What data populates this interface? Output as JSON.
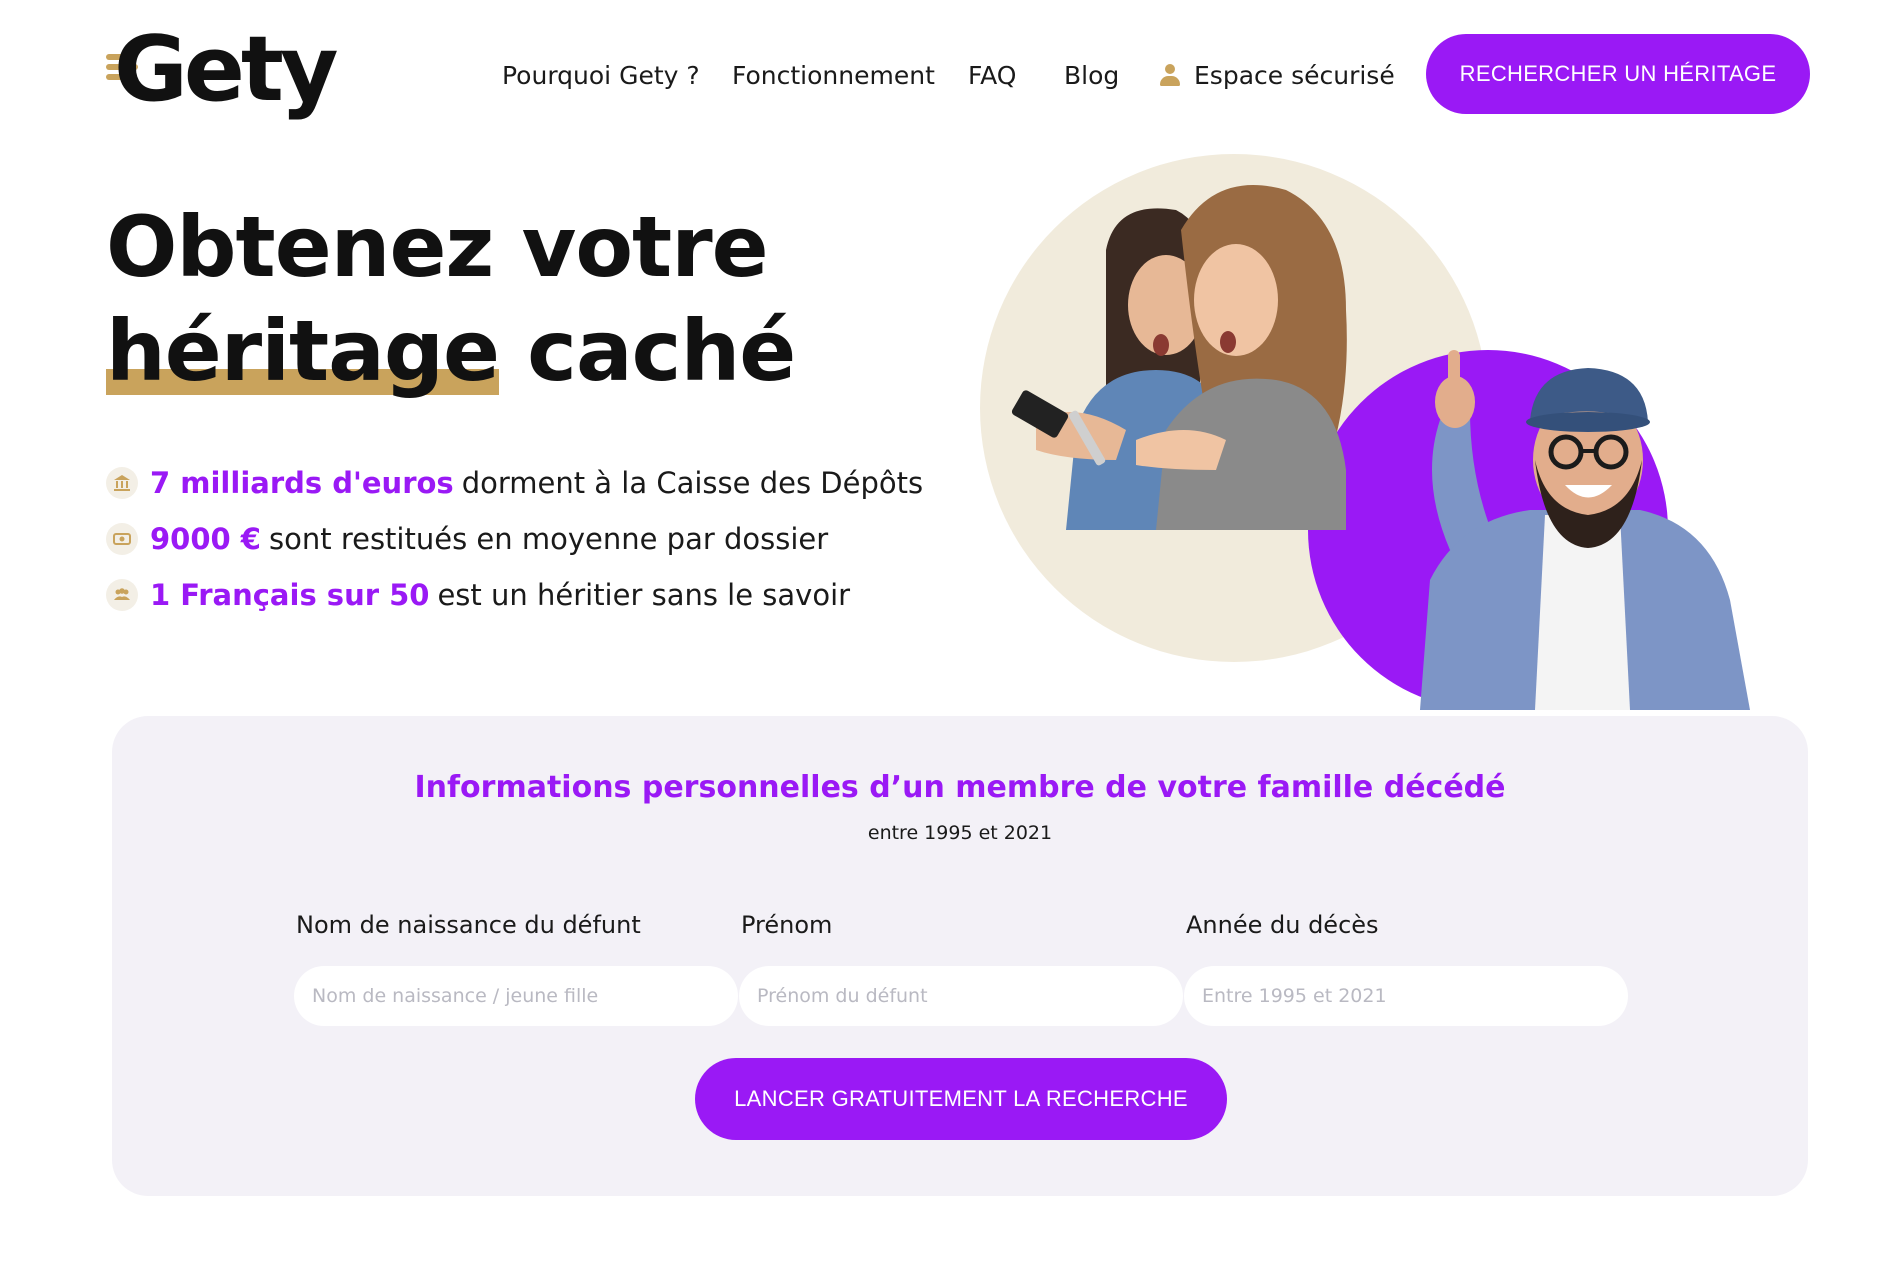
{
  "brand": {
    "logo_text": "Gety",
    "accent_color": "#9a19f5",
    "gold_color": "#c9a35c"
  },
  "nav": {
    "items": [
      {
        "label": "Pourquoi Gety ?"
      },
      {
        "label": "Fonctionnement"
      },
      {
        "label": "FAQ"
      },
      {
        "label": "Blog"
      }
    ],
    "secure_label": "Espace sécurisé",
    "secure_icon": "user-icon",
    "cta_label": "RECHERCHER UN HÉRITAGE"
  },
  "hero": {
    "title_line1": "Obtenez votre",
    "title_highlight": "héritage",
    "title_rest": " caché",
    "stats": [
      {
        "icon": "bank-icon",
        "strong": "7 milliards d'euros",
        "rest": "dorment à la Caisse des Dépôts"
      },
      {
        "icon": "money-icon",
        "strong": "9000 €",
        "rest": "sont restitués en moyenne par dossier"
      },
      {
        "icon": "people-icon",
        "strong": "1 Français sur 50",
        "rest": "est un héritier sans le savoir"
      }
    ]
  },
  "search": {
    "title": "Informations personnelles d’un membre de votre famille décédé",
    "subtitle": "entre 1995 et 2021",
    "fields": [
      {
        "label": "Nom de naissance du défunt",
        "placeholder": "Nom de naissance / jeune fille",
        "value": ""
      },
      {
        "label": "Prénom",
        "placeholder": "Prénom du défunt",
        "value": ""
      },
      {
        "label": "Année du décès",
        "placeholder": "Entre 1995 et 2021",
        "value": ""
      }
    ],
    "submit_label": "LANCER GRATUITEMENT LA RECHERCHE"
  }
}
